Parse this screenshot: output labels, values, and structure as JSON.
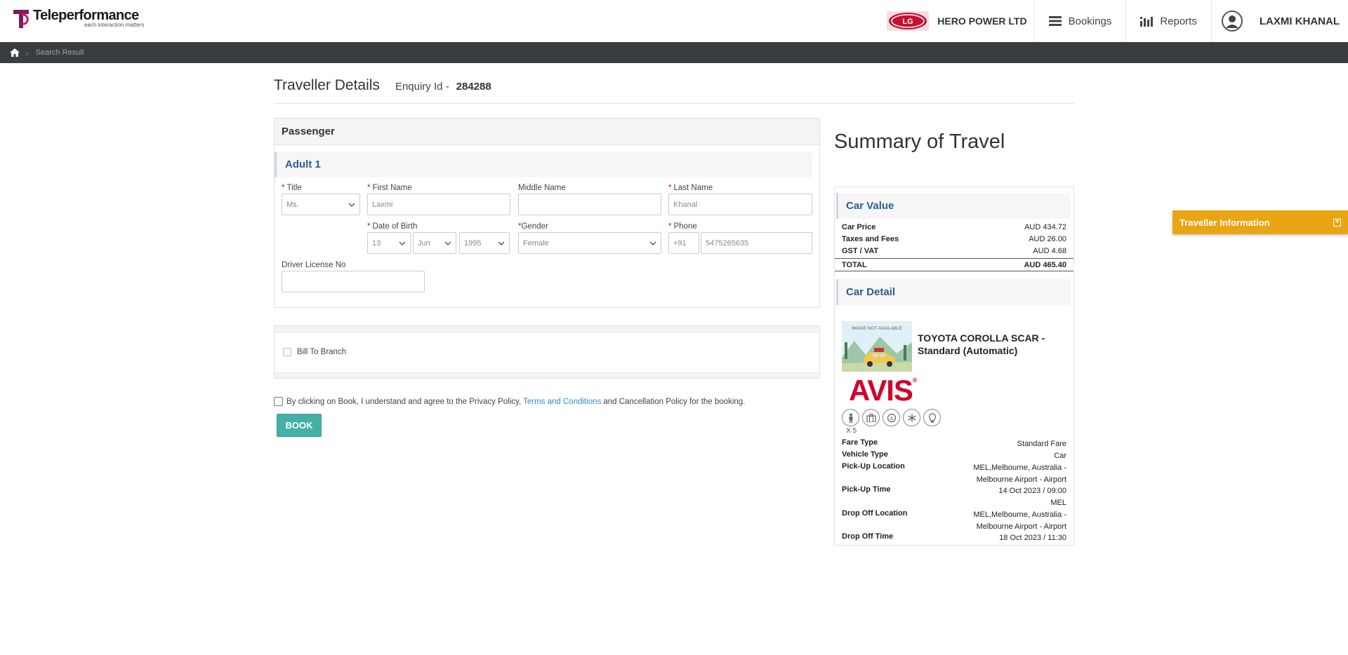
{
  "brand": {
    "name": "Teleperformance",
    "tagline": "each interaction matters",
    "accent": "#7b1c5a"
  },
  "header": {
    "company_name": "HERO POWER LTD",
    "company_logo_text": "LG",
    "nav": [
      {
        "label": "Bookings",
        "icon": "list-icon"
      },
      {
        "label": "Reports",
        "icon": "bar-chart-icon"
      }
    ],
    "user_name": "LAXMI KHANAL"
  },
  "breadcrumb": {
    "current": "Search Result"
  },
  "page": {
    "title": "Traveller Details",
    "enquiry_label": "Enquiry Id -",
    "enquiry_id": "284288"
  },
  "passenger": {
    "section_title": "Passenger",
    "adult_label": "Adult 1",
    "fields": {
      "title": {
        "label": "Title",
        "value": "Ms."
      },
      "first_name": {
        "label": "First Name",
        "value": "Laxmi"
      },
      "middle_name": {
        "label": "Middle Name",
        "value": ""
      },
      "last_name": {
        "label": "Last Name",
        "value": "Khanal"
      },
      "dob": {
        "label": "Date of Birth",
        "day": "13",
        "month": "Jun",
        "year": "1995"
      },
      "gender": {
        "label": "Gender",
        "value": "Female"
      },
      "phone": {
        "label": "Phone",
        "code": "+91",
        "number": "5475265635"
      },
      "license": {
        "label": "Driver License No",
        "value": ""
      }
    }
  },
  "bill_to_branch": {
    "label": "Bill To Branch"
  },
  "agreement": {
    "text_before": "By clicking on Book, I understand and agree to the Privacy Policy,",
    "link_text": "Terms and Conditions",
    "text_after": "and Cancellation Policy for the booking."
  },
  "book_button": {
    "label": "BOOK",
    "color": "#45b0a8"
  },
  "summary": {
    "title": "Summary of Travel",
    "car_value": {
      "heading": "Car Value",
      "rows": [
        {
          "label": "Car Price",
          "value": "AUD 434.72"
        },
        {
          "label": "Taxes and Fees",
          "value": "AUD 26.00"
        },
        {
          "label": "GST / VAT",
          "value": "AUD 4.68"
        }
      ],
      "total_label": "TOTAL",
      "total_value": "AUD 465.40"
    },
    "car_detail": {
      "heading": "Car Detail",
      "image_text": "IMAGE NOT AVAILABLE",
      "car_name": "TOYOTA COROLLA SCAR - Standard (Automatic)",
      "vendor": "AVIS",
      "feature_icons": [
        "passenger-icon",
        "luggage-icon",
        "transmission-icon",
        "air-conditioning-icon",
        "fuel-icon"
      ],
      "passenger_count": "X 5",
      "rows": [
        {
          "label": "Fare Type",
          "value": "Standard Fare"
        },
        {
          "label": "Vehicle Type",
          "value": "Car"
        },
        {
          "label": "Pick-Up Location",
          "value": "MEL,Melbourne, Australia - Melbourne Airport - Airport"
        },
        {
          "label": "Pick-Up Time",
          "value": "14 Oct 2023 / 09:00 MEL"
        },
        {
          "label": "Drop Off Location",
          "value": "MEL,Melbourne, Australia - Melbourne Airport - Airport"
        },
        {
          "label": "Drop Off Time",
          "value": "18 Oct 2023 / 11:30"
        }
      ]
    }
  },
  "traveller_info_tab": {
    "label": "Traveller Information",
    "color": "#e9a514"
  }
}
